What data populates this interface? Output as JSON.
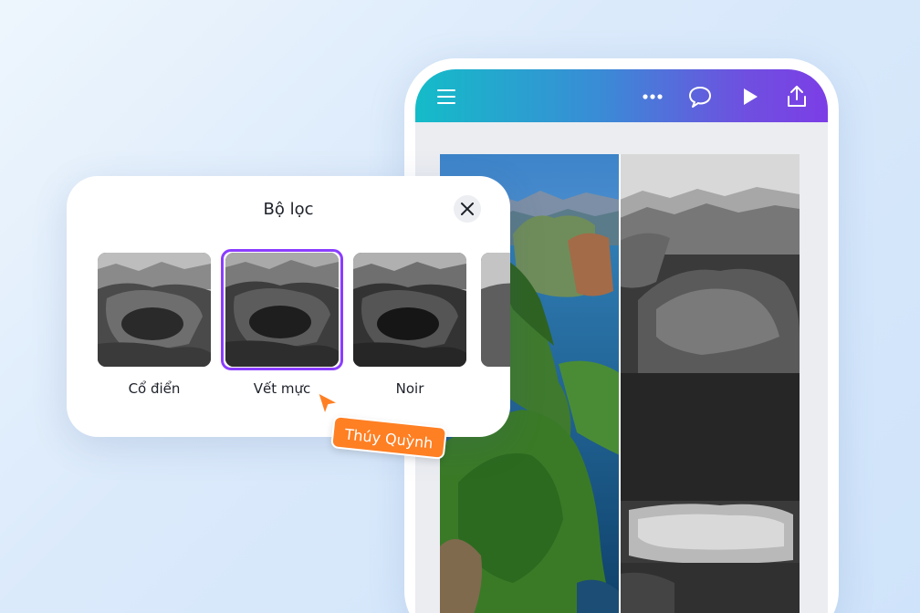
{
  "filter_panel": {
    "title": "Bộ lọc",
    "filters": [
      {
        "label": "Cổ điển",
        "selected": false
      },
      {
        "label": "Vết mực",
        "selected": true
      },
      {
        "label": "Noir",
        "selected": false
      }
    ]
  },
  "collaborator": {
    "name": "Thúy Quỳnh",
    "color": "#ff7f23"
  },
  "toolbar": {
    "icons": [
      "menu-icon",
      "more-icon",
      "comment-icon",
      "present-icon",
      "share-icon"
    ],
    "gradient": [
      "#14bcc8",
      "#7c3ee6"
    ]
  },
  "colors": {
    "accent": "#8b3dff",
    "background": "#dbeafb"
  }
}
